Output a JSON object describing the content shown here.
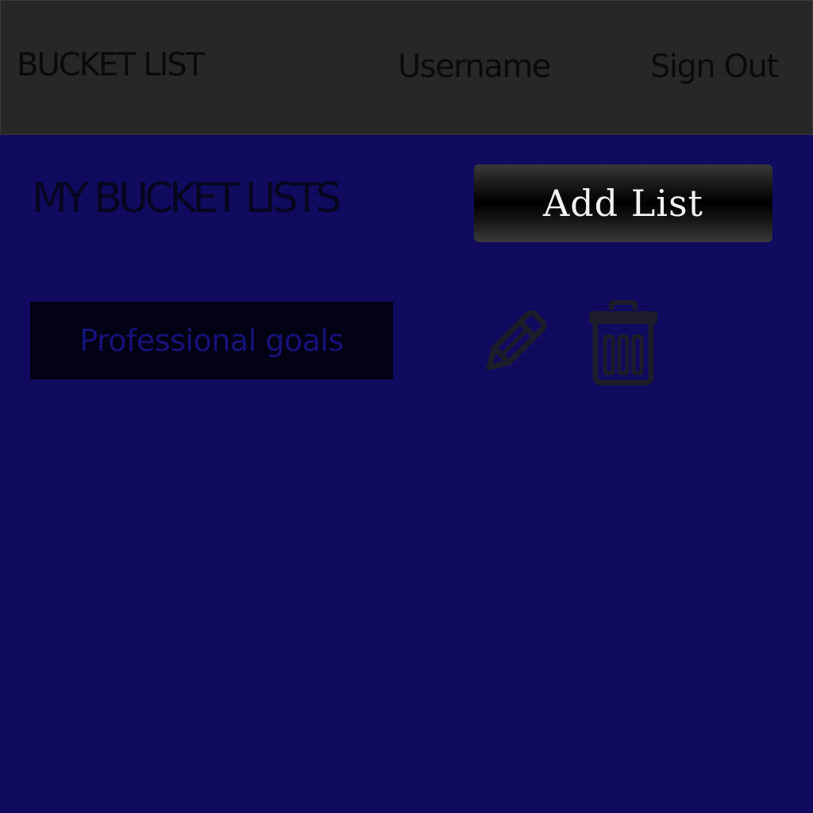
{
  "header": {
    "brand": "BUCKET LIST",
    "username": "Username",
    "sign_out": "Sign Out"
  },
  "main": {
    "title": "MY BUCKET LISTS",
    "add_button": "Add List",
    "lists": [
      {
        "name": "Professional goals",
        "actions": [
          "pencil-icon",
          "trash-icon"
        ]
      }
    ]
  },
  "colors": {
    "header_bg": "#272727",
    "page_bg": "#100b5e",
    "list_item_bg": "#030214",
    "list_item_text": "#16127a",
    "button_text": "#f2f2f2"
  }
}
